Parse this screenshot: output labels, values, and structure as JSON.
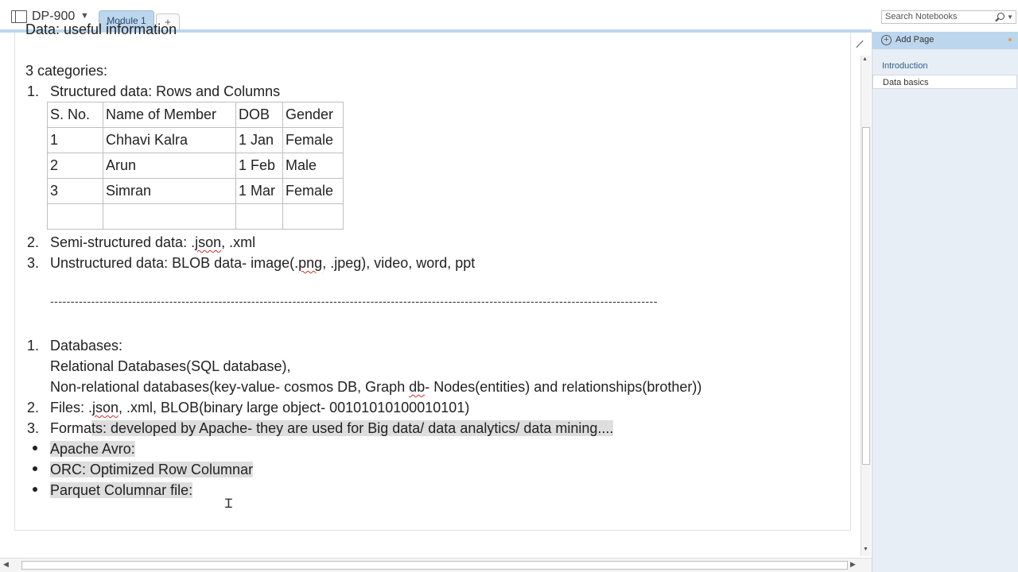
{
  "header": {
    "notebook": "DP-900",
    "tabs": [
      {
        "label": "Module 1"
      }
    ],
    "add_tab": "+",
    "search_placeholder": "Search Notebooks"
  },
  "pages_panel": {
    "add_page": "Add Page",
    "section": "Introduction",
    "pages": [
      {
        "label": "Data basics"
      }
    ]
  },
  "note": {
    "cut_heading": "Data: useful information",
    "intro": "3 categories:",
    "list1": [
      {
        "num": "1.",
        "text": "Structured data: Rows and Columns"
      },
      {
        "num": "2.",
        "text_pre": "Semi-structured data: .",
        "text_sq": "json",
        "text_post": ", .xml"
      },
      {
        "num": "3.",
        "text_pre": "Unstructured data: BLOB data- image(.",
        "text_sq": "png",
        "text_post": ", .jpeg), video, word, ppt"
      }
    ],
    "table": {
      "headers": [
        "S. No.",
        "Name of Member",
        "DOB",
        "Gender"
      ],
      "rows": [
        [
          "1",
          "Chhavi Kalra",
          "1 Jan",
          "Female"
        ],
        [
          "2",
          "Arun",
          "1 Feb",
          "Male"
        ],
        [
          "3",
          "Simran",
          "1 Mar",
          "Female"
        ],
        [
          "",
          "",
          "",
          ""
        ]
      ]
    },
    "separator": "----------------------------------------------------------------------------------------------------------------------------------------------------",
    "list2": {
      "item1_num": "1.",
      "item1": "Databases:",
      "item1_sub1": "Relational Databases(SQL database),",
      "item1_sub2_pre": "Non-relational databases(key-value- cosmos DB, Graph  ",
      "item1_sub2_sq": "db",
      "item1_sub2_post": "- Nodes(entities) and relationships(brother))",
      "item2_num": "2.",
      "item2_pre": "Files: .",
      "item2_sq": "json",
      "item2_post": ", .xml, BLOB(binary large object- 00101010100010101)",
      "item3_num": "3.",
      "item3_a": "Forma",
      "item3_b": "ts: developed by Apache- they are used for Big data/ data analytics/ data mining.... "
    },
    "bullets": [
      "Apache Avro: ",
      "ORC: Optimized Row Columnar ",
      "Parquet Columnar file: "
    ]
  }
}
